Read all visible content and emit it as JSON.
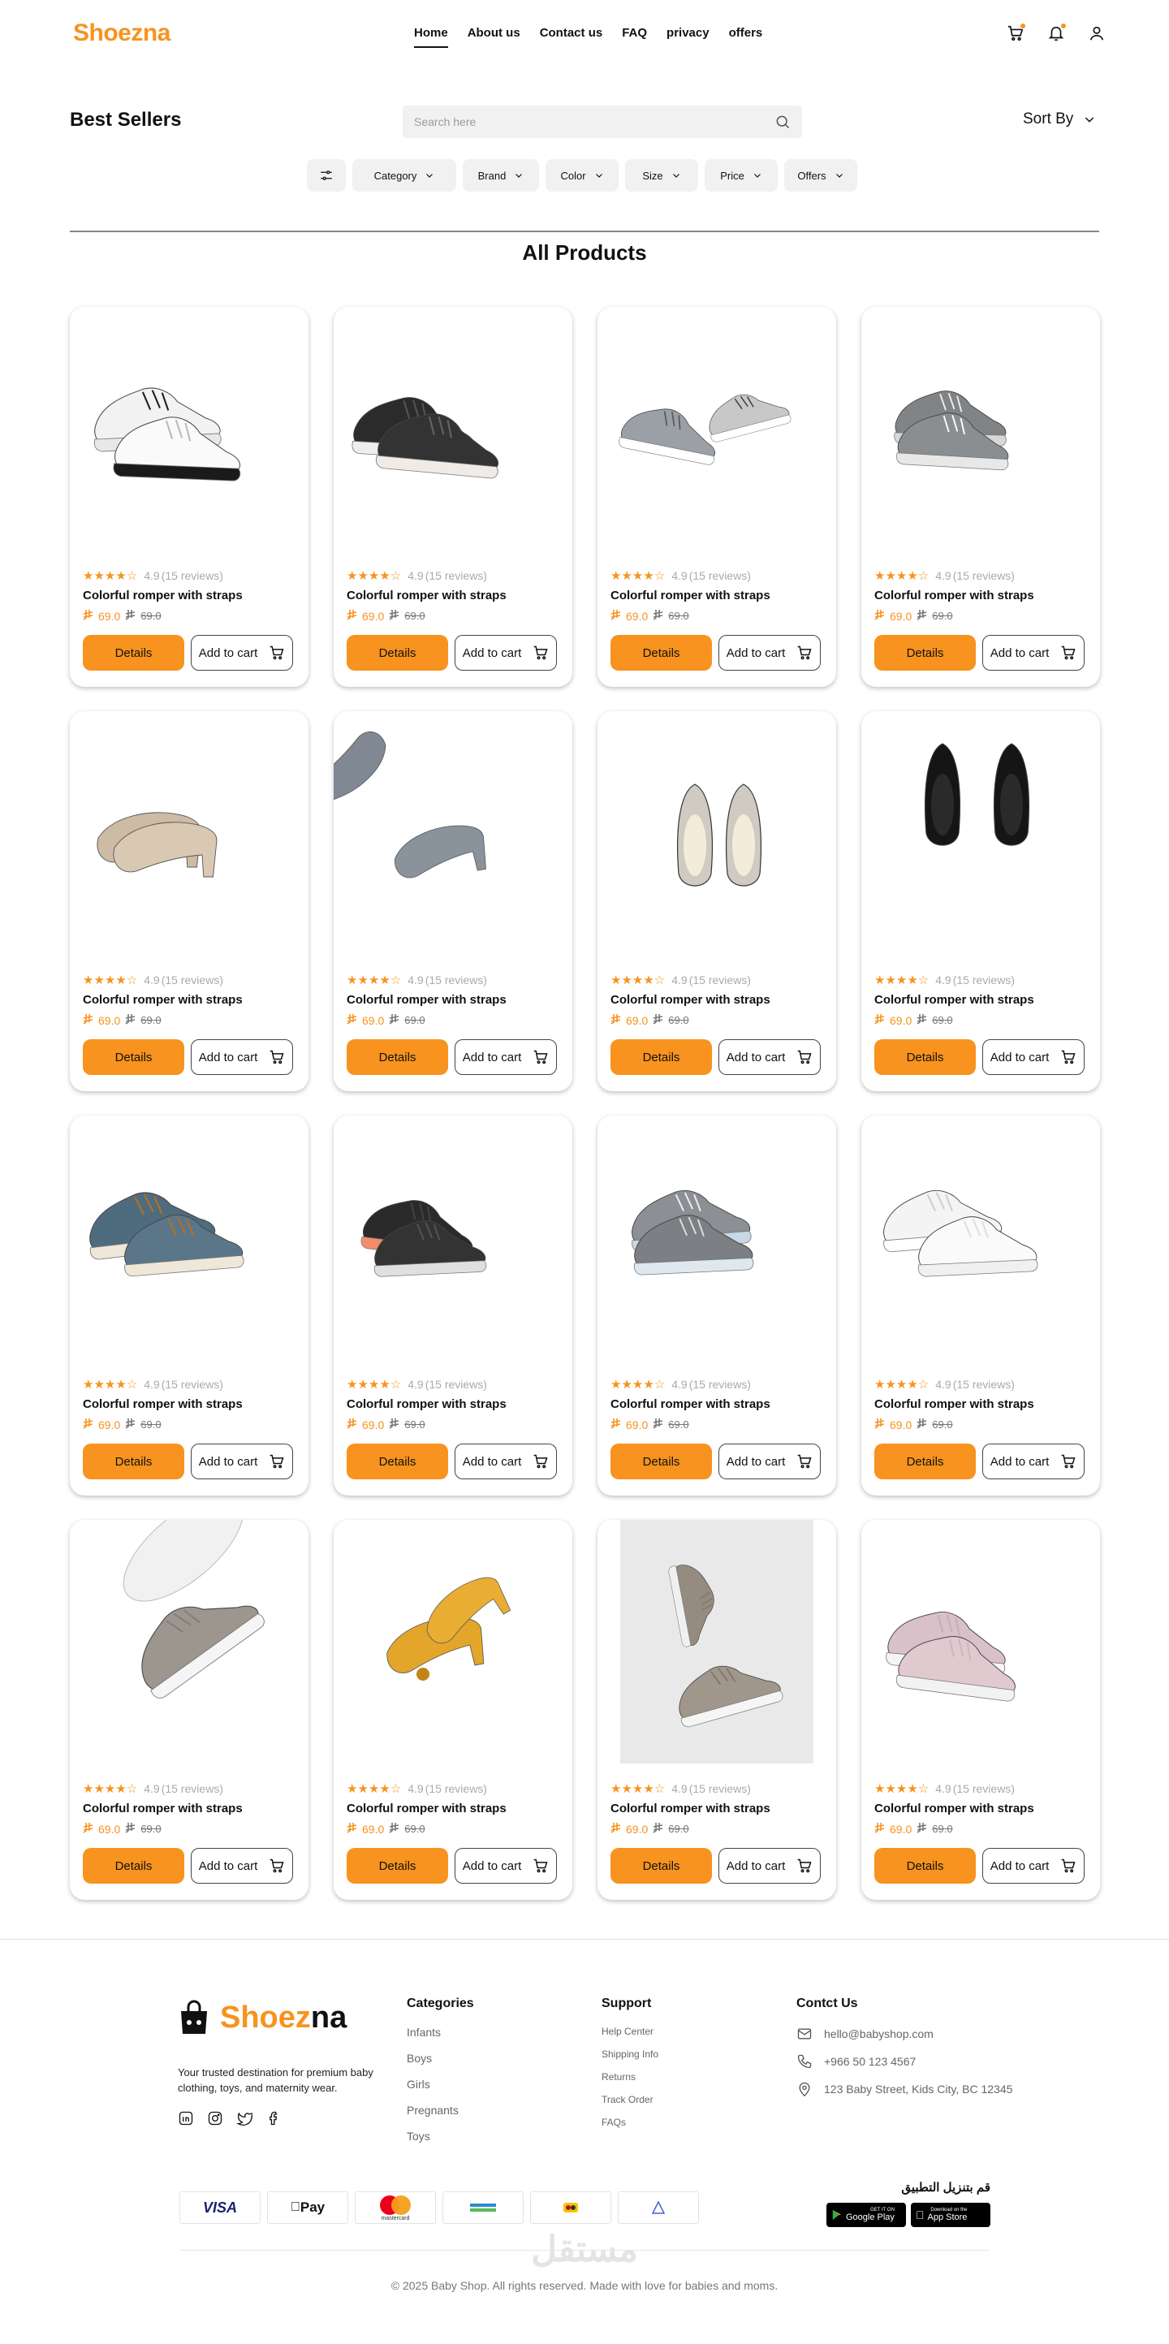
{
  "header": {
    "logo_brand": "Shoez",
    "logo_suffix": "na",
    "nav": [
      {
        "label": "Home",
        "active": true
      },
      {
        "label": "About us"
      },
      {
        "label": "Contact us"
      },
      {
        "label": "FAQ"
      },
      {
        "label": "privacy"
      },
      {
        "label": "offers"
      }
    ],
    "icons": [
      "cart-icon",
      "bell-icon",
      "user-icon"
    ]
  },
  "toolbar": {
    "title": "Best Sellers",
    "search_placeholder": "Search here",
    "sort_label": "Sort By",
    "filters": [
      "Category",
      "Brand",
      "Color",
      "Size",
      "Price",
      "Offers"
    ]
  },
  "section_title": "All Products",
  "products": [
    {
      "shoe": "white-sneaker",
      "rating": "4.9",
      "reviews": "(15 reviews)",
      "name": "Colorful romper with straps",
      "price": "69.0",
      "old_price": "69.0",
      "details": "Details",
      "cart": "Add to cart"
    },
    {
      "shoe": "black-knit-sneaker",
      "rating": "4.9",
      "reviews": "(15 reviews)",
      "name": "Colorful romper with straps",
      "price": "69.0",
      "old_price": "69.0",
      "details": "Details",
      "cart": "Add to cart"
    },
    {
      "shoe": "grey-runner",
      "rating": "4.9",
      "reviews": "(15 reviews)",
      "name": "Colorful romper with straps",
      "price": "69.0",
      "old_price": "69.0",
      "details": "Details",
      "cart": "Add to cart"
    },
    {
      "shoe": "grey-mesh-sneaker",
      "rating": "4.9",
      "reviews": "(15 reviews)",
      "name": "Colorful romper with straps",
      "price": "69.0",
      "old_price": "69.0",
      "details": "Details",
      "cart": "Add to cart"
    },
    {
      "shoe": "beige-heels",
      "rating": "4.9",
      "reviews": "(15 reviews)",
      "name": "Colorful romper with straps",
      "price": "69.0",
      "old_price": "69.0",
      "details": "Details",
      "cart": "Add to cart"
    },
    {
      "shoe": "grey-suede-heels",
      "rating": "4.9",
      "reviews": "(15 reviews)",
      "name": "Colorful romper with straps",
      "price": "69.0",
      "old_price": "69.0",
      "details": "Details",
      "cart": "Add to cart"
    },
    {
      "shoe": "cream-flats",
      "rating": "4.9",
      "reviews": "(15 reviews)",
      "name": "Colorful romper with straps",
      "price": "69.0",
      "old_price": "69.0",
      "details": "Details",
      "cart": "Add to cart"
    },
    {
      "shoe": "black-patent-flats",
      "rating": "4.9",
      "reviews": "(15 reviews)",
      "name": "Colorful romper with straps",
      "price": "69.0",
      "old_price": "69.0",
      "details": "Details",
      "cart": "Add to cart"
    },
    {
      "shoe": "denim-sneaker",
      "rating": "4.9",
      "reviews": "(15 reviews)",
      "name": "Colorful romper with straps",
      "price": "69.0",
      "old_price": "69.0",
      "details": "Details",
      "cart": "Add to cart"
    },
    {
      "shoe": "black-runner",
      "rating": "4.9",
      "reviews": "(15 reviews)",
      "name": "Colorful romper with straps",
      "price": "69.0",
      "old_price": "69.0",
      "details": "Details",
      "cart": "Add to cart"
    },
    {
      "shoe": "grey-air-sneaker",
      "rating": "4.9",
      "reviews": "(15 reviews)",
      "name": "Colorful romper with straps",
      "price": "69.0",
      "old_price": "69.0",
      "details": "Details",
      "cart": "Add to cart"
    },
    {
      "shoe": "white-platform-sneaker",
      "rating": "4.9",
      "reviews": "(15 reviews)",
      "name": "Colorful romper with straps",
      "price": "69.0",
      "old_price": "69.0",
      "details": "Details",
      "cart": "Add to cart"
    },
    {
      "shoe": "taupe-knit-slipon",
      "rating": "4.9",
      "reviews": "(15 reviews)",
      "name": "Colorful romper with straps",
      "price": "69.0",
      "old_price": "69.0",
      "details": "Details",
      "cart": "Add to cart"
    },
    {
      "shoe": "yellow-bow-flats",
      "rating": "4.9",
      "reviews": "(15 reviews)",
      "name": "Colorful romper with straps",
      "price": "69.0",
      "old_price": "69.0",
      "details": "Details",
      "cart": "Add to cart"
    },
    {
      "shoe": "taupe-walker",
      "rating": "4.9",
      "reviews": "(15 reviews)",
      "name": "Colorful romper with straps",
      "price": "69.0",
      "old_price": "69.0",
      "details": "Details",
      "cart": "Add to cart"
    },
    {
      "shoe": "pink-knit-slipon",
      "rating": "4.9",
      "reviews": "(15 reviews)",
      "name": "Colorful romper with straps",
      "price": "69.0",
      "old_price": "69.0",
      "details": "Details",
      "cart": "Add to cart"
    }
  ],
  "footer": {
    "brand": "Shoez",
    "brand_suffix": "na",
    "tagline": "Your trusted destination for premium baby clothing, toys, and maternity wear.",
    "social": [
      "linkedin-icon",
      "instagram-icon",
      "twitter-icon",
      "facebook-icon"
    ],
    "categories_title": "Categories",
    "categories": [
      "Infants",
      "Boys",
      "Girls",
      "Pregnants",
      "Toys"
    ],
    "support_title": "Support",
    "support": [
      "Help Center",
      "Shipping Info",
      "Returns",
      "Track Order",
      "FAQs"
    ],
    "contact_title": "Contct Us",
    "email": "hello@babyshop.com",
    "phone": "+966 50 123 4567",
    "address": "123 Baby Street, Kids City, BC 12345",
    "payments": [
      "VISA",
      "Pay",
      "mastercard",
      "",
      "",
      ""
    ],
    "app_title": "قم بتنزيل التطبيق",
    "google_small": "GET IT ON",
    "google_big": "Google Play",
    "apple_small": "Download on the",
    "apple_big": "App Store",
    "watermark": "مستقل",
    "copyright": "© 2025 Baby Shop. All rights reserved. Made with love for babies and moms."
  },
  "colors": {
    "accent": "#F7931E",
    "text": "#111111"
  }
}
